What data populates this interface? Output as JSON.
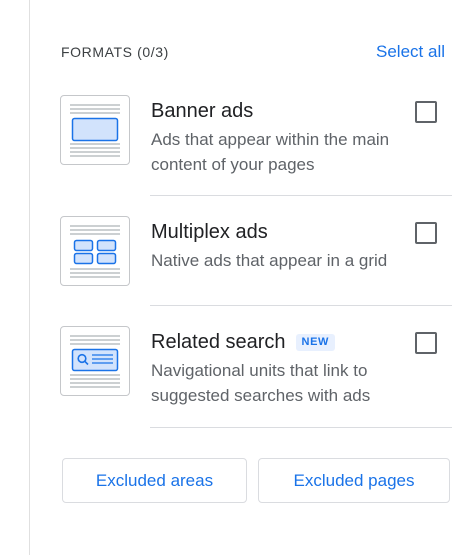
{
  "formats": {
    "section_title": "FORMATS (0/3)",
    "select_all_label": "Select all",
    "items": [
      {
        "title": "Banner ads",
        "description": "Ads that appear within the main content of your pages",
        "checked": false,
        "icon": "banner-ad-thumbnail-icon"
      },
      {
        "title": "Multiplex ads",
        "description": "Native ads that appear in a grid",
        "checked": false,
        "icon": "multiplex-ad-thumbnail-icon"
      },
      {
        "title": "Related search",
        "badge": "NEW",
        "description": "Navigational units that link to suggested searches with ads",
        "checked": false,
        "icon": "related-search-thumbnail-icon"
      }
    ]
  },
  "buttons": {
    "excluded_areas": "Excluded areas",
    "excluded_pages": "Excluded pages"
  },
  "colors": {
    "accent": "#1a73e8",
    "thumb_fill": "#d2e3fc",
    "thumb_stroke": "#1a73e8",
    "line_gray": "#9aa0a6"
  }
}
